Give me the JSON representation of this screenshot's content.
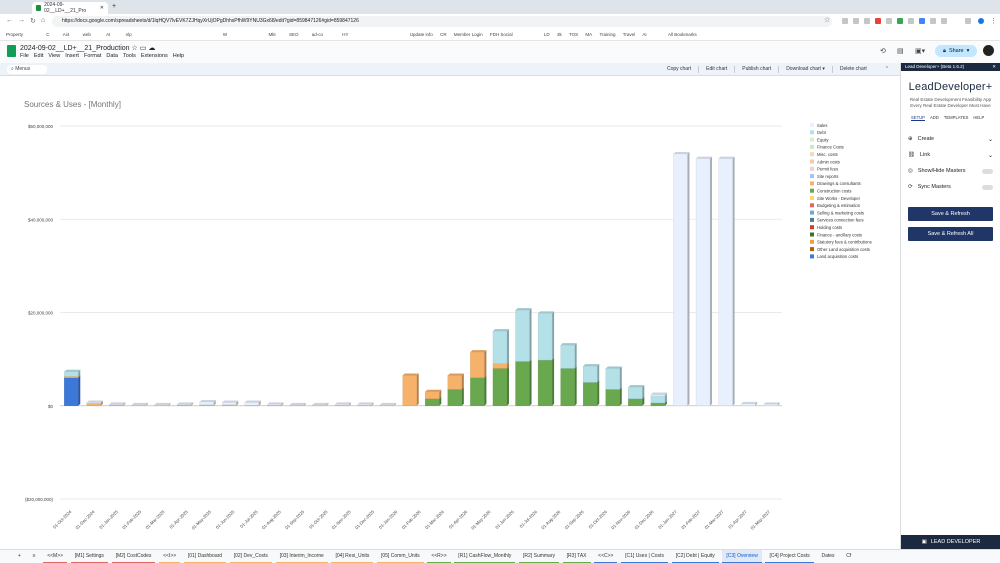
{
  "browser": {
    "tab_title": "2024-09-02__LD+__21_Pro",
    "url": "https://docs.google.com/spreadsheets/d/1lqHQV7lvEVK7ZJHqyXrUjOPgDhhsPfhW9YNU3Gx68/edit?gid=859847126#gid=859847126",
    "bookmarks": [
      "Property",
      "C",
      "Ai4",
      "web",
      "AI",
      "nlp",
      "W",
      "Mkt",
      "SEO",
      "ad-co",
      "HY",
      "Update info",
      "CR",
      "Member Login",
      "FDH Social",
      "LD",
      "3k",
      "TOS",
      "MA",
      "Training",
      "Travel",
      "AI",
      "All Bookmarks"
    ]
  },
  "doc": {
    "title": "2024-09-02__LD+__21_Production",
    "menus": [
      "File",
      "Edit",
      "View",
      "Insert",
      "Format",
      "Data",
      "Tools",
      "Extensions",
      "Help"
    ],
    "share_label": "Share"
  },
  "chart_toolbar": {
    "search_label": "Menus",
    "actions": [
      "Copy chart",
      "Edit chart",
      "Publish chart",
      "Download chart ▾",
      "Delete chart"
    ]
  },
  "chart_data": {
    "type": "bar",
    "title": "Sources & Uses - [Monthly]",
    "ylim": [
      -20000000,
      60000000
    ],
    "y_ticks": [
      "$60,000,000",
      "$40,000,000",
      "$20,000,000",
      "$0",
      "($20,000,000)"
    ],
    "y_tick_values": [
      60000000,
      40000000,
      20000000,
      0,
      -20000000
    ],
    "legend_position": "right",
    "grid": true,
    "categories": [
      "01-Oct-2024",
      "01-Nov-2024",
      "01-Dec-2024",
      "01-Jan-2025",
      "01-Feb-2025",
      "01-Mar-2025",
      "01-Apr-2025",
      "01-May-2025",
      "01-Jun-2025",
      "01-Jul-2025",
      "01-Aug-2025",
      "01-Sep-2025",
      "01-Oct-2025",
      "01-Nov-2025",
      "01-Dec-2025",
      "01-Jan-2026",
      "01-Feb-2026",
      "01-Mar-2026",
      "01-Apr-2026",
      "01-May-2026",
      "01-Jun-2026",
      "01-Jul-2026",
      "01-Aug-2026",
      "01-Sep-2026",
      "01-Oct-2026",
      "01-Nov-2026",
      "01-Dec-2026",
      "01-Jan-2027",
      "01-Feb-2027",
      "01-Mar-2027",
      "01-Apr-2027",
      "01-May-2027"
    ],
    "tick_labels": [
      "01-Oct-2024",
      "01-Dec-2024",
      "01-Jan-2025",
      "01-Feb-2025",
      "01-Mar-2025",
      "01-Apr-2025",
      "01-May-2025",
      "01-Jun-2025",
      "01-Jul-2025",
      "01-Aug-2025",
      "01-Sep-2025",
      "01-Oct-2025",
      "01-Nov-2025",
      "01-Dec-2025",
      "01-Jan-2026",
      "01-Feb-2026",
      "01-Mar-2026",
      "01-Apr-2026",
      "01-May-2026",
      "01-Jun-2026",
      "01-Jul-2026",
      "01-Aug-2026",
      "01-Sep-2026",
      "01-Oct-2026",
      "01-Nov-2026",
      "01-Dec-2026",
      "01-Jan-2027",
      "01-Feb-2027",
      "01-Mar-2027",
      "01-Apr-2027",
      "01-May-2027"
    ],
    "legend": [
      {
        "name": "Sales",
        "color": "#e8f0fe"
      },
      {
        "name": "Debt",
        "color": "#b4e1e8"
      },
      {
        "name": "Equity",
        "color": "#d9f0c9"
      },
      {
        "name": "Finance Costs",
        "color": "#cfe8c8"
      },
      {
        "name": "Misc. costs",
        "color": "#f4d9b8"
      },
      {
        "name": "Admin costs",
        "color": "#f6c9a8"
      },
      {
        "name": "Permit fees",
        "color": "#ead1dc"
      },
      {
        "name": "Site reports",
        "color": "#a4c2f4"
      },
      {
        "name": "Drawings & consultants",
        "color": "#f6b26b"
      },
      {
        "name": "Construction costs",
        "color": "#6aa84f"
      },
      {
        "name": "Site Works - Developer",
        "color": "#ffd966"
      },
      {
        "name": "Budgeting & estimation",
        "color": "#e06666"
      },
      {
        "name": "Selling & marketing costs",
        "color": "#6fa8dc"
      },
      {
        "name": "Services connection fees",
        "color": "#45818e"
      },
      {
        "name": "Holding costs",
        "color": "#cc4125"
      },
      {
        "name": "Finance - ancillary costs",
        "color": "#38761d"
      },
      {
        "name": "Statutory fees & contributions",
        "color": "#f1a03c"
      },
      {
        "name": "Other Land acquisition costs",
        "color": "#b45f06"
      },
      {
        "name": "Land acquisition costs",
        "color": "#3c78d8"
      }
    ],
    "series": [
      {
        "name": "Land acquisition costs",
        "values": [
          6000000,
          0,
          0,
          0,
          0,
          0,
          0,
          0,
          0,
          0,
          0,
          0,
          0,
          0,
          0,
          0,
          0,
          0,
          0,
          0,
          0,
          0,
          0,
          0,
          0,
          0,
          0,
          0,
          0,
          0,
          0,
          0
        ]
      },
      {
        "name": "Construction costs",
        "values": [
          0,
          0,
          0,
          0,
          0,
          0,
          0,
          0,
          0,
          0,
          0,
          0,
          0,
          0,
          0,
          0,
          1500000,
          3500000,
          6000000,
          8000000,
          9500000,
          9800000,
          8000000,
          5000000,
          3500000,
          1500000,
          600000,
          0,
          0,
          0,
          0,
          0
        ]
      },
      {
        "name": "Drawings & consultants",
        "values": [
          300000,
          400000,
          200000,
          100000,
          100000,
          200000,
          200000,
          200000,
          100000,
          100000,
          100000,
          100000,
          100000,
          100000,
          100000,
          6500000,
          1500000,
          3000000,
          5500000,
          1000000,
          0,
          0,
          0,
          0,
          0,
          0,
          0,
          0,
          0,
          0,
          0,
          0
        ]
      },
      {
        "name": "Debt",
        "values": [
          1000000,
          200000,
          0,
          0,
          0,
          0,
          0,
          0,
          0,
          0,
          0,
          0,
          0,
          0,
          0,
          0,
          0,
          0,
          0,
          7000000,
          11000000,
          10000000,
          5000000,
          3500000,
          4500000,
          2500000,
          1500000,
          0,
          0,
          0,
          0,
          0
        ]
      },
      {
        "name": "Sales",
        "values": [
          0,
          100000,
          100000,
          100000,
          100000,
          100000,
          600000,
          500000,
          600000,
          200000,
          100000,
          100000,
          200000,
          200000,
          100000,
          0,
          0,
          0,
          0,
          0,
          0,
          0,
          0,
          0,
          0,
          0,
          300000,
          54000000,
          53000000,
          53000000,
          400000,
          300000
        ]
      }
    ]
  },
  "side_panel": {
    "header": "Lead Developer+ (Beta 1.6.2)",
    "brand": "LeadDeveloper+",
    "tagline1": "Real Estate Development Feasibility App",
    "tagline2": "Every Real Estate Developer Must Have",
    "tabs": [
      "SETUP",
      "ADD",
      "TEMPLATES",
      "HELP"
    ],
    "items": [
      "Create",
      "Link",
      "Show/Hide Masters",
      "Sync Masters"
    ],
    "btn_refresh": "Save & Refresh",
    "btn_refresh_all": "Save & Refresh All",
    "footer": "LEAD DEVELOPER"
  },
  "sheet_tabs": [
    "<<M>>",
    "[M1] Settings",
    "[M2] CostCodes",
    "<<I>>",
    "[01] Dashboard",
    "[02] Dev_Costs",
    "[03] Interim_Income",
    "[04] Resi_Units",
    "[05] Comm_Units",
    "<<R>>",
    "[R1] CashFlow_Monthly",
    "[R2] Summary",
    "[R3] TAX",
    "<<C>>",
    "[C1] Uses | Costs",
    "[C2] Debt | Equity",
    "[C3] Overview",
    "[C4] Project Costs",
    "Dates",
    "Cf"
  ],
  "active_sheet": "[C3] Overview"
}
